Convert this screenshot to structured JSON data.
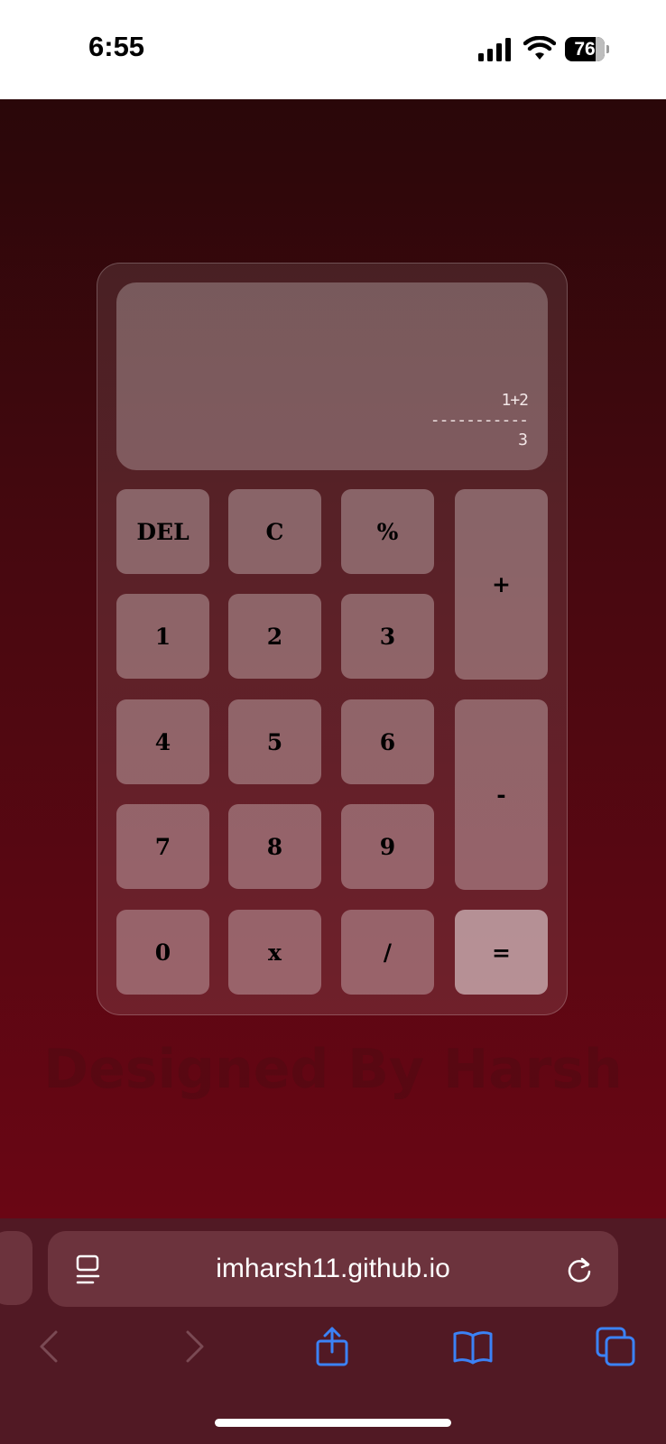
{
  "status_bar": {
    "time": "6:55",
    "battery_level": "76",
    "icons": [
      "cellular-signal-icon",
      "wifi-icon",
      "battery-icon"
    ]
  },
  "calculator": {
    "display": {
      "expression": "1+2",
      "divider": "-----------",
      "result": "3"
    },
    "keys": {
      "del": "DEL",
      "clear": "C",
      "percent": "%",
      "plus": "+",
      "one": "1",
      "two": "2",
      "three": "3",
      "four": "4",
      "five": "5",
      "six": "6",
      "minus": "-",
      "seven": "7",
      "eight": "8",
      "nine": "9",
      "zero": "0",
      "multiply": "x",
      "divide": "/",
      "equals": "="
    }
  },
  "credit": "Designed By Harsh",
  "browser": {
    "url": "imharsh11.github.io",
    "icons": [
      "reader-icon",
      "reload-icon",
      "back-icon",
      "forward-icon",
      "share-icon",
      "bookmarks-icon",
      "tabs-icon"
    ],
    "accent_color": "#3b82f6"
  },
  "colors": {
    "background_top": "#2a0709",
    "background_bottom": "#6a0614",
    "browser_chrome": "#511924"
  }
}
